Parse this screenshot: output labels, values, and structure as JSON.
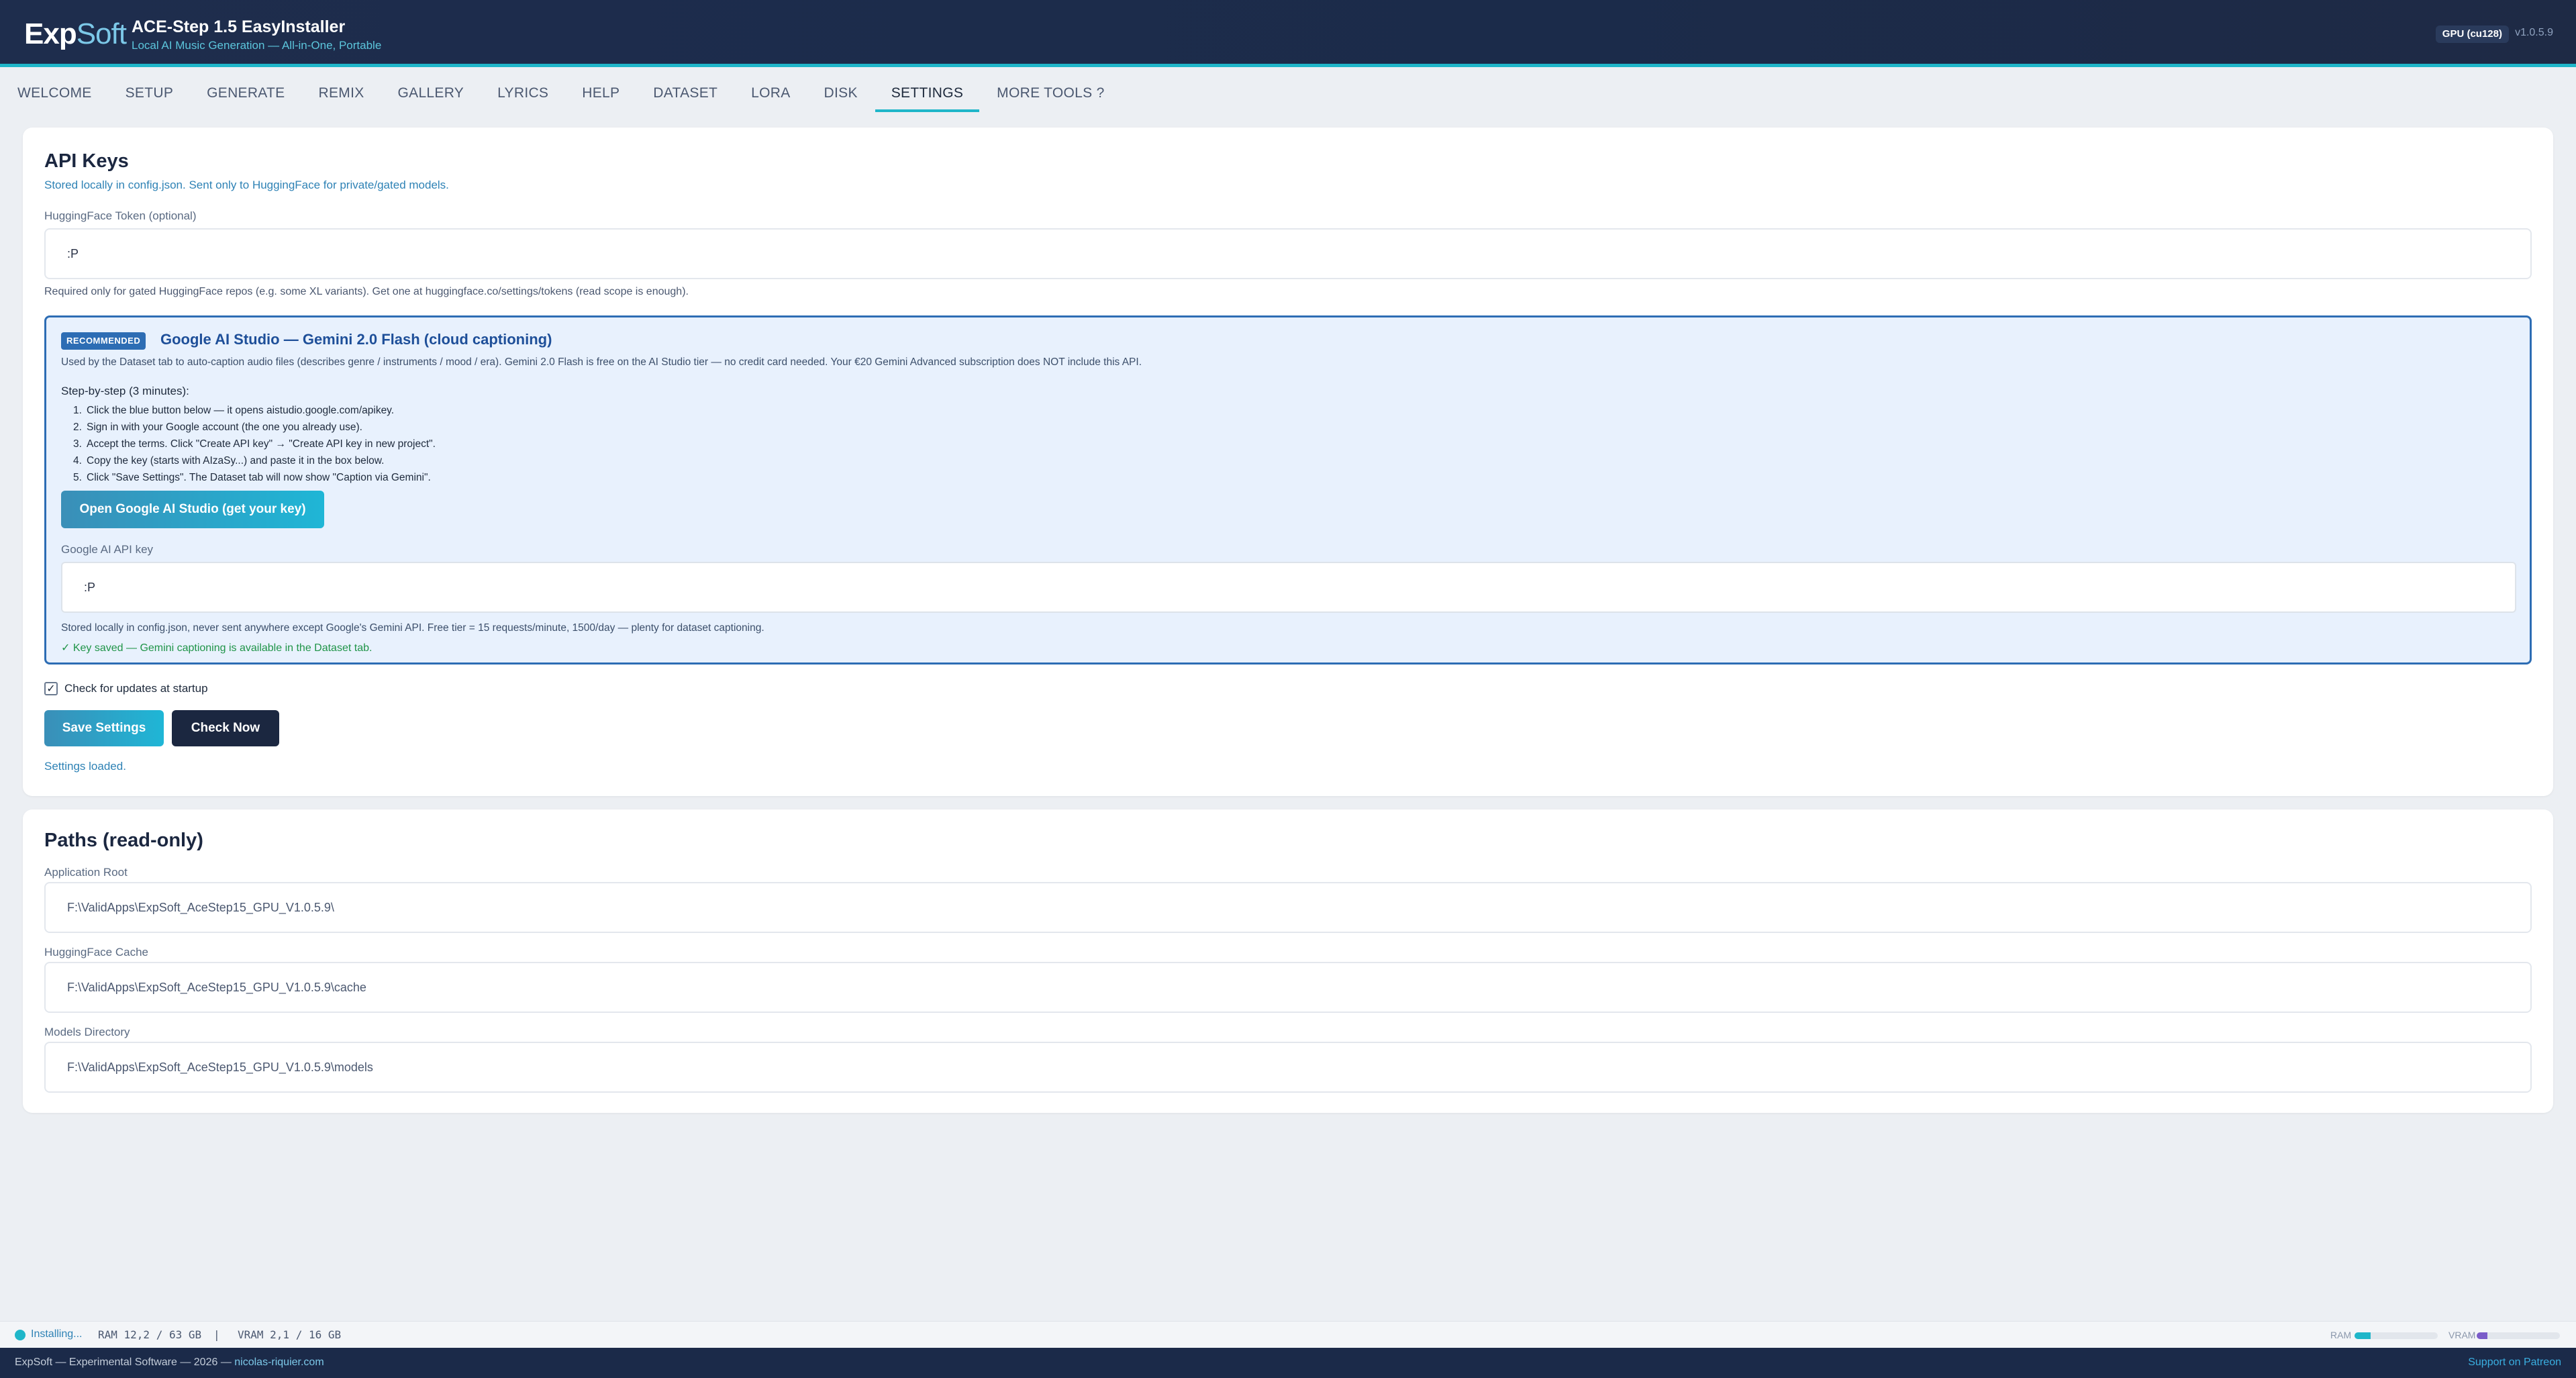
{
  "header": {
    "logo_exp": "Exp",
    "logo_soft": "Soft",
    "title": "ACE-Step 1.5 EasyInstaller",
    "subtitle": "Local AI Music Generation — All-in-One, Portable",
    "gpu_badge": "GPU (cu128)",
    "version": "v1.0.5.9"
  },
  "tabs": [
    "WELCOME",
    "SETUP",
    "GENERATE",
    "REMIX",
    "GALLERY",
    "LYRICS",
    "HELP",
    "DATASET",
    "LORA",
    "DISK",
    "SETTINGS",
    "MORE TOOLS ?"
  ],
  "active_tab": "SETTINGS",
  "api_keys": {
    "title": "API Keys",
    "subtitle": "Stored locally in config.json. Sent only to HuggingFace for private/gated models.",
    "hf_label": "HuggingFace Token (optional)",
    "hf_value": ":P",
    "hf_help": "Required only for gated HuggingFace repos (e.g. some XL variants). Get one at huggingface.co/settings/tokens (read scope is enough).",
    "gemini": {
      "badge": "RECOMMENDED",
      "title": "Google AI Studio — Gemini 2.0 Flash (cloud captioning)",
      "description": "Used by the Dataset tab to auto-caption audio files (describes genre / instruments / mood / era). Gemini 2.0 Flash is free on the AI Studio tier — no credit card needed. Your €20 Gemini Advanced subscription does NOT include this API.",
      "steps_title": "Step-by-step (3 minutes):",
      "steps": [
        "Click the blue button below — it opens aistudio.google.com/apikey.",
        "Sign in with your Google account (the one you already use).",
        "Accept the terms. Click \"Create API key\" → \"Create API key in new project\".",
        "Copy the key (starts with AIzaSy...) and paste it in the box below.",
        "Click \"Save Settings\". The Dataset tab will now show \"Caption via Gemini\"."
      ],
      "button": "Open Google AI Studio (get your key)",
      "key_label": "Google AI API key",
      "key_value": ":P",
      "key_help": "Stored locally in config.json, never sent anywhere except Google's Gemini API. Free tier = 15 requests/minute, 1500/day — plenty for dataset captioning.",
      "saved_msg": "✓ Key saved — Gemini captioning is available in the Dataset tab."
    },
    "check_updates_label": "Check for updates at startup",
    "check_updates_checked": true,
    "save_button": "Save Settings",
    "check_now_button": "Check Now",
    "status": "Settings loaded."
  },
  "paths": {
    "title": "Paths (read-only)",
    "app_root_label": "Application Root",
    "app_root": "F:\\ValidApps\\ExpSoft_AceStep15_GPU_V1.0.5.9\\",
    "hf_cache_label": "HuggingFace Cache",
    "hf_cache": "F:\\ValidApps\\ExpSoft_AceStep15_GPU_V1.0.5.9\\cache",
    "models_label": "Models Directory",
    "models": "F:\\ValidApps\\ExpSoft_AceStep15_GPU_V1.0.5.9\\models"
  },
  "statusbar": {
    "installing": "Installing...",
    "ram": "RAM 12,2 / 63 GB",
    "separator": "|",
    "vram": "VRAM 2,1 / 16 GB",
    "ram_meter_label": "RAM",
    "ram_fraction": 0.19,
    "vram_meter_label": "VRAM",
    "vram_fraction": 0.13,
    "ram_color": "#1fb6c9",
    "vram_color": "#7a5cc9"
  },
  "footer": {
    "left": "ExpSoft — Experimental Software — 2026 —",
    "link": "nicolas-riquier.com",
    "right": "Support on Patreon"
  },
  "colors": {
    "accent": "#1fb6c9",
    "header_bg": "#1e2d4d",
    "gemini_border": "#2d6db4",
    "success": "#1f9448"
  }
}
